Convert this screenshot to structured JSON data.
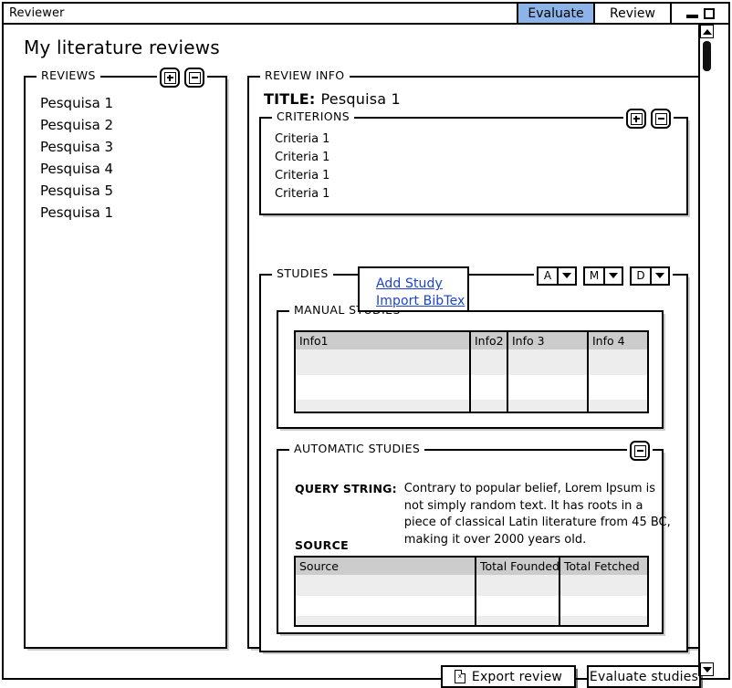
{
  "window": {
    "app_title": "Reviewer",
    "tabs": [
      {
        "label": "Evaluate",
        "active": true
      },
      {
        "label": "Review",
        "active": false
      }
    ],
    "controls": {
      "minimize": "minimize-icon",
      "maximize": "maximize-icon"
    }
  },
  "page": {
    "title": "My literature reviews"
  },
  "reviews_panel": {
    "legend": "REVIEWS",
    "add_button": "add-icon",
    "remove_button": "remove-icon",
    "items": [
      "Pesquisa 1",
      "Pesquisa 2",
      "Pesquisa 3",
      "Pesquisa 4",
      "Pesquisa 5",
      "Pesquisa 1"
    ]
  },
  "review_info": {
    "legend": "REVIEW INFO",
    "title_label": "TITLE:",
    "title_value": "Pesquisa 1",
    "criterions": {
      "legend": "CRITERIONS",
      "add_button": "add-icon",
      "remove_button": "remove-icon",
      "items": [
        "Criteria 1",
        "Criteria 1",
        "Criteria 1",
        "Criteria 1"
      ]
    },
    "studies": {
      "legend": "STUDIES",
      "split_buttons": [
        {
          "label": "A",
          "caret": "chevron-down-icon"
        },
        {
          "label": "M",
          "caret": "chevron-down-icon"
        },
        {
          "label": "D",
          "caret": "chevron-down-icon"
        }
      ],
      "dropdown": {
        "open_for": "M",
        "items": [
          "Add Study",
          "Import BibTex"
        ]
      },
      "manual_studies": {
        "legend": "MANUAL STUDIES",
        "table": {
          "columns": [
            "Info1",
            "Info2",
            "Info 3",
            "Info 4"
          ],
          "rows": [
            [
              "",
              "",
              "",
              ""
            ],
            [
              "",
              "",
              "",
              ""
            ],
            [
              "",
              "",
              "",
              ""
            ]
          ]
        }
      },
      "automatic_studies": {
        "legend": "AUTOMATIC STUDIES",
        "remove_button": "remove-icon",
        "query_label": "QUERY STRING:",
        "query_text": "Contrary to popular belief, Lorem Ipsum is not simply random text. It has roots in a piece of classical Latin literature from 45 BC, making it over 2000 years old.",
        "source_label": "SOURCE",
        "table": {
          "columns": [
            "Source",
            "Total Founded",
            "Total Fetched"
          ],
          "rows": [
            [
              "",
              "",
              ""
            ],
            [
              "",
              "",
              ""
            ],
            [
              "",
              "",
              ""
            ]
          ]
        }
      }
    },
    "actions": {
      "export_label": "Export review",
      "export_icon": "spreadsheet-file-icon",
      "export_icon_glyph": "x",
      "evaluate_label": "Evaluate studies"
    }
  },
  "scrollbar": {
    "up_arrow": "chevron-up-icon",
    "down_arrow": "chevron-down-icon",
    "thumb": "scroll-thumb"
  },
  "colors": {
    "accent_tab": "#8cb4e8",
    "table_header": "#cccccc",
    "row_stripe": "#ededed",
    "link": "#1b44c8"
  }
}
